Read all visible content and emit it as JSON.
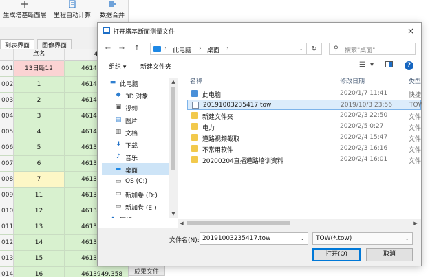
{
  "app": {
    "ribbon": [
      {
        "label": "生成塔基断面层",
        "icon": "terrain-icon"
      },
      {
        "label": "里程自动计算",
        "icon": "calculator-icon"
      },
      {
        "label": "数据合并",
        "icon": "merge-icon"
      }
    ],
    "subtabs": [
      "列表界面",
      "图像界面"
    ],
    "grid_header": [
      "点名",
      "4"
    ],
    "rows": [
      {
        "idx": "001",
        "name": "13日断12",
        "val": "4614"
      },
      {
        "idx": "002",
        "name": "1",
        "val": "4614"
      },
      {
        "idx": "003",
        "name": "2",
        "val": "4614"
      },
      {
        "idx": "004",
        "name": "3",
        "val": "4614"
      },
      {
        "idx": "005",
        "name": "4",
        "val": "4614"
      },
      {
        "idx": "006",
        "name": "5",
        "val": "4613"
      },
      {
        "idx": "007",
        "name": "6",
        "val": "4613"
      },
      {
        "idx": "008",
        "name": "7",
        "val": "4613"
      },
      {
        "idx": "009",
        "name": "11",
        "val": "4613"
      },
      {
        "idx": "010",
        "name": "12",
        "val": "4613"
      },
      {
        "idx": "011",
        "name": "13",
        "val": "4613"
      },
      {
        "idx": "012",
        "name": "14",
        "val": "4613"
      },
      {
        "idx": "013",
        "name": "15",
        "val": "4613"
      },
      {
        "idx": "014",
        "name": "16",
        "val": "4613949.358"
      }
    ],
    "bottom_tab": "成果文件"
  },
  "dialog": {
    "title": "打开塔基断面测量文件",
    "close": "×",
    "nav": {
      "back": "←",
      "forward": "→",
      "up": "↑",
      "crumbs": [
        "此电脑",
        "桌面"
      ],
      "sep": "›",
      "dropdown": "⌄",
      "refresh": "↻"
    },
    "search_placeholder": "搜索\"桌面\"",
    "toolbar": {
      "organize": "组织 ▾",
      "new_folder": "新建文件夹",
      "help": "?"
    },
    "nav_pane": [
      {
        "label": "此电脑",
        "icon": "computer-icon",
        "glyph": "▬"
      },
      {
        "label": "3D 对象",
        "icon": "cube-icon",
        "glyph": "◆"
      },
      {
        "label": "视频",
        "icon": "video-icon",
        "glyph": "▣"
      },
      {
        "label": "图片",
        "icon": "picture-icon",
        "glyph": "▤"
      },
      {
        "label": "文档",
        "icon": "document-icon",
        "glyph": "▥"
      },
      {
        "label": "下载",
        "icon": "download-icon",
        "glyph": "⬇"
      },
      {
        "label": "音乐",
        "icon": "music-icon",
        "glyph": "♪"
      },
      {
        "label": "桌面",
        "icon": "desktop-icon",
        "glyph": "▬"
      },
      {
        "label": "OS (C:)",
        "icon": "drive-icon",
        "glyph": "▭"
      },
      {
        "label": "新加卷 (D:)",
        "icon": "drive-icon",
        "glyph": "▭"
      },
      {
        "label": "新加卷 (E:)",
        "icon": "drive-icon",
        "glyph": "▭"
      },
      {
        "label": "网络",
        "icon": "network-icon",
        "glyph": "▲"
      }
    ],
    "columns": {
      "name": "名称",
      "date": "修改日期",
      "type": "类型"
    },
    "files": [
      {
        "name": "此电脑",
        "date": "2020/1/7 11:41",
        "type": "快捷",
        "kind": "pc"
      },
      {
        "name": "20191003235417.tow",
        "date": "2019/10/3 23:56",
        "type": "TOW",
        "kind": "doc"
      },
      {
        "name": "新建文件夹",
        "date": "2020/2/3 22:50",
        "type": "文件",
        "kind": "folder"
      },
      {
        "name": "电力",
        "date": "2020/2/5 0:27",
        "type": "文件",
        "kind": "folder"
      },
      {
        "name": "道路视频截取",
        "date": "2020/2/4 15:47",
        "type": "文件",
        "kind": "folder"
      },
      {
        "name": "不常用软件",
        "date": "2020/2/3 16:16",
        "type": "文件",
        "kind": "folder"
      },
      {
        "name": "20200204直播道路培训资料",
        "date": "2020/2/4 16:01",
        "type": "文件",
        "kind": "folder"
      }
    ],
    "filename_label": "文件名(N):",
    "filename_value": "20191003235417.tow",
    "filetype_value": "TOW(*.tow)",
    "open_label": "打开(O)",
    "cancel_label": "取消",
    "colors": {
      "accent": "#0078d7",
      "selected_bg": "#dcecfb"
    }
  }
}
